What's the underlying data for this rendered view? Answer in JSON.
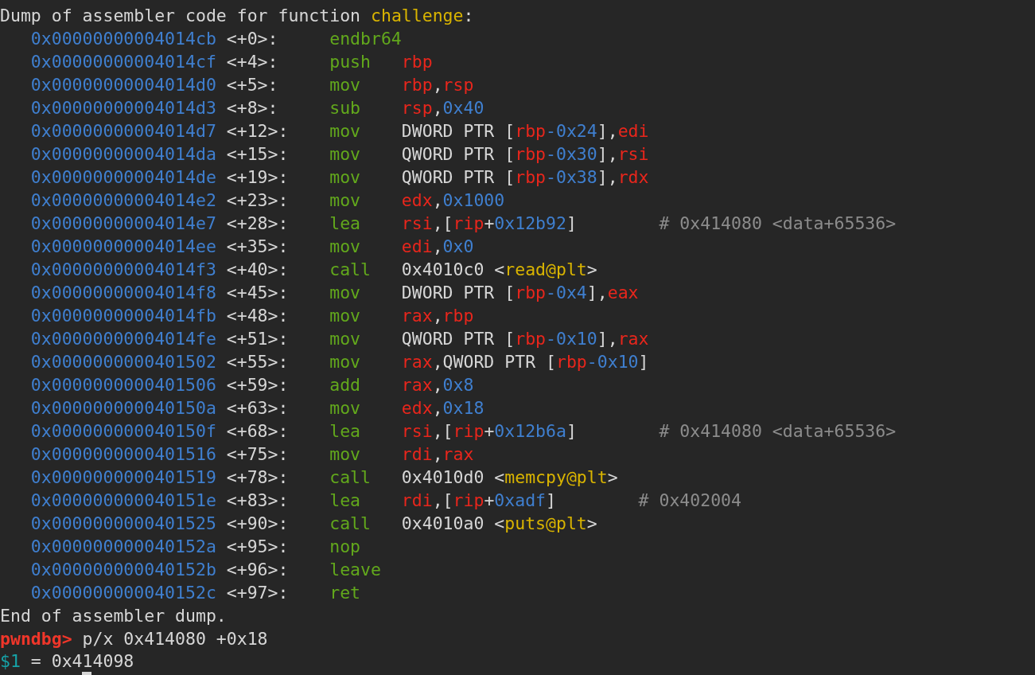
{
  "header": [
    {
      "text": "Dump of assembler code for function ",
      "kind": "plain"
    },
    {
      "text": "challenge",
      "kind": "sym"
    },
    {
      "text": ":",
      "kind": "plain"
    }
  ],
  "instructions": [
    {
      "address": "0x00000000004014cb",
      "offset": "<+0>:",
      "mnemonic": "endbr64"
    },
    {
      "address": "0x00000000004014cf",
      "offset": "<+4>:",
      "mnemonic": "push",
      "operands": [
        {
          "text": "rbp",
          "kind": "reg"
        }
      ]
    },
    {
      "address": "0x00000000004014d0",
      "offset": "<+5>:",
      "mnemonic": "mov",
      "operands": [
        {
          "text": "rbp",
          "kind": "reg"
        },
        {
          "text": ",",
          "kind": "plain"
        },
        {
          "text": "rsp",
          "kind": "reg"
        }
      ]
    },
    {
      "address": "0x00000000004014d3",
      "offset": "<+8>:",
      "mnemonic": "sub",
      "operands": [
        {
          "text": "rsp",
          "kind": "reg"
        },
        {
          "text": ",",
          "kind": "plain"
        },
        {
          "text": "0x40",
          "kind": "num"
        }
      ]
    },
    {
      "address": "0x00000000004014d7",
      "offset": "<+12>:",
      "mnemonic": "mov",
      "operands": [
        {
          "text": "DWORD PTR [",
          "kind": "plain"
        },
        {
          "text": "rbp",
          "kind": "reg"
        },
        {
          "text": "-0x24",
          "kind": "num"
        },
        {
          "text": "],",
          "kind": "plain"
        },
        {
          "text": "edi",
          "kind": "reg"
        }
      ]
    },
    {
      "address": "0x00000000004014da",
      "offset": "<+15>:",
      "mnemonic": "mov",
      "operands": [
        {
          "text": "QWORD PTR [",
          "kind": "plain"
        },
        {
          "text": "rbp",
          "kind": "reg"
        },
        {
          "text": "-0x30",
          "kind": "num"
        },
        {
          "text": "],",
          "kind": "plain"
        },
        {
          "text": "rsi",
          "kind": "reg"
        }
      ]
    },
    {
      "address": "0x00000000004014de",
      "offset": "<+19>:",
      "mnemonic": "mov",
      "operands": [
        {
          "text": "QWORD PTR [",
          "kind": "plain"
        },
        {
          "text": "rbp",
          "kind": "reg"
        },
        {
          "text": "-0x38",
          "kind": "num"
        },
        {
          "text": "],",
          "kind": "plain"
        },
        {
          "text": "rdx",
          "kind": "reg"
        }
      ]
    },
    {
      "address": "0x00000000004014e2",
      "offset": "<+23>:",
      "mnemonic": "mov",
      "operands": [
        {
          "text": "edx",
          "kind": "reg"
        },
        {
          "text": ",",
          "kind": "plain"
        },
        {
          "text": "0x1000",
          "kind": "num"
        }
      ]
    },
    {
      "address": "0x00000000004014e7",
      "offset": "<+28>:",
      "mnemonic": "lea",
      "operands": [
        {
          "text": "rsi",
          "kind": "reg"
        },
        {
          "text": ",[",
          "kind": "plain"
        },
        {
          "text": "rip",
          "kind": "reg"
        },
        {
          "text": "+",
          "kind": "plain"
        },
        {
          "text": "0x12b92",
          "kind": "num"
        },
        {
          "text": "]",
          "kind": "plain"
        }
      ],
      "comment": "# 0x414080 <data+65536>"
    },
    {
      "address": "0x00000000004014ee",
      "offset": "<+35>:",
      "mnemonic": "mov",
      "operands": [
        {
          "text": "edi",
          "kind": "reg"
        },
        {
          "text": ",",
          "kind": "plain"
        },
        {
          "text": "0x0",
          "kind": "num"
        }
      ]
    },
    {
      "address": "0x00000000004014f3",
      "offset": "<+40>:",
      "mnemonic": "call",
      "operands": [
        {
          "text": "0x4010c0 <",
          "kind": "plain"
        },
        {
          "text": "read@plt",
          "kind": "sym"
        },
        {
          "text": ">",
          "kind": "plain"
        }
      ]
    },
    {
      "address": "0x00000000004014f8",
      "offset": "<+45>:",
      "mnemonic": "mov",
      "operands": [
        {
          "text": "DWORD PTR [",
          "kind": "plain"
        },
        {
          "text": "rbp",
          "kind": "reg"
        },
        {
          "text": "-0x4",
          "kind": "num"
        },
        {
          "text": "],",
          "kind": "plain"
        },
        {
          "text": "eax",
          "kind": "reg"
        }
      ]
    },
    {
      "address": "0x00000000004014fb",
      "offset": "<+48>:",
      "mnemonic": "mov",
      "operands": [
        {
          "text": "rax",
          "kind": "reg"
        },
        {
          "text": ",",
          "kind": "plain"
        },
        {
          "text": "rbp",
          "kind": "reg"
        }
      ]
    },
    {
      "address": "0x00000000004014fe",
      "offset": "<+51>:",
      "mnemonic": "mov",
      "operands": [
        {
          "text": "QWORD PTR [",
          "kind": "plain"
        },
        {
          "text": "rbp",
          "kind": "reg"
        },
        {
          "text": "-0x10",
          "kind": "num"
        },
        {
          "text": "],",
          "kind": "plain"
        },
        {
          "text": "rax",
          "kind": "reg"
        }
      ]
    },
    {
      "address": "0x0000000000401502",
      "offset": "<+55>:",
      "mnemonic": "mov",
      "operands": [
        {
          "text": "rax",
          "kind": "reg"
        },
        {
          "text": ",QWORD PTR [",
          "kind": "plain"
        },
        {
          "text": "rbp",
          "kind": "reg"
        },
        {
          "text": "-0x10",
          "kind": "num"
        },
        {
          "text": "]",
          "kind": "plain"
        }
      ]
    },
    {
      "address": "0x0000000000401506",
      "offset": "<+59>:",
      "mnemonic": "add",
      "operands": [
        {
          "text": "rax",
          "kind": "reg"
        },
        {
          "text": ",",
          "kind": "plain"
        },
        {
          "text": "0x8",
          "kind": "num"
        }
      ]
    },
    {
      "address": "0x000000000040150a",
      "offset": "<+63>:",
      "mnemonic": "mov",
      "operands": [
        {
          "text": "edx",
          "kind": "reg"
        },
        {
          "text": ",",
          "kind": "plain"
        },
        {
          "text": "0x18",
          "kind": "num"
        }
      ]
    },
    {
      "address": "0x000000000040150f",
      "offset": "<+68>:",
      "mnemonic": "lea",
      "operands": [
        {
          "text": "rsi",
          "kind": "reg"
        },
        {
          "text": ",[",
          "kind": "plain"
        },
        {
          "text": "rip",
          "kind": "reg"
        },
        {
          "text": "+",
          "kind": "plain"
        },
        {
          "text": "0x12b6a",
          "kind": "num"
        },
        {
          "text": "]",
          "kind": "plain"
        }
      ],
      "comment": "# 0x414080 <data+65536>"
    },
    {
      "address": "0x0000000000401516",
      "offset": "<+75>:",
      "mnemonic": "mov",
      "operands": [
        {
          "text": "rdi",
          "kind": "reg"
        },
        {
          "text": ",",
          "kind": "plain"
        },
        {
          "text": "rax",
          "kind": "reg"
        }
      ]
    },
    {
      "address": "0x0000000000401519",
      "offset": "<+78>:",
      "mnemonic": "call",
      "operands": [
        {
          "text": "0x4010d0 <",
          "kind": "plain"
        },
        {
          "text": "memcpy@plt",
          "kind": "sym"
        },
        {
          "text": ">",
          "kind": "plain"
        }
      ]
    },
    {
      "address": "0x000000000040151e",
      "offset": "<+83>:",
      "mnemonic": "lea",
      "operands": [
        {
          "text": "rdi",
          "kind": "reg"
        },
        {
          "text": ",[",
          "kind": "plain"
        },
        {
          "text": "rip",
          "kind": "reg"
        },
        {
          "text": "+",
          "kind": "plain"
        },
        {
          "text": "0xadf",
          "kind": "num"
        },
        {
          "text": "]",
          "kind": "plain"
        }
      ],
      "comment": "# 0x402004"
    },
    {
      "address": "0x0000000000401525",
      "offset": "<+90>:",
      "mnemonic": "call",
      "operands": [
        {
          "text": "0x4010a0 <",
          "kind": "plain"
        },
        {
          "text": "puts@plt",
          "kind": "sym"
        },
        {
          "text": ">",
          "kind": "plain"
        }
      ]
    },
    {
      "address": "0x000000000040152a",
      "offset": "<+95>:",
      "mnemonic": "nop"
    },
    {
      "address": "0x000000000040152b",
      "offset": "<+96>:",
      "mnemonic": "leave"
    },
    {
      "address": "0x000000000040152c",
      "offset": "<+97>:",
      "mnemonic": "ret"
    }
  ],
  "footer": "End of assembler dump.",
  "prompt": {
    "label": "pwndbg>",
    "command": "p/x 0x414080 +0x18"
  },
  "result": {
    "variable": "$1",
    "value": "= 0x414098"
  }
}
